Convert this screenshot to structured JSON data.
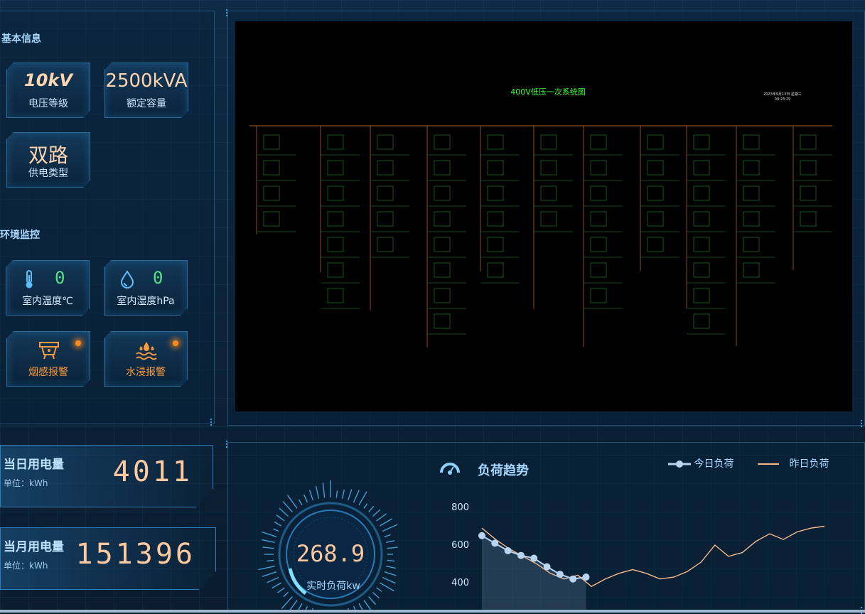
{
  "basic_info": {
    "title": "基本信息",
    "voltage": {
      "value": "10kV",
      "label": "电压等级"
    },
    "capacity": {
      "value": "2500kVA",
      "label": "额定容量"
    },
    "supply": {
      "value": "双路",
      "label": "供电类型"
    }
  },
  "env": {
    "title": "环境监控",
    "temperature": {
      "value": "0",
      "label": "室内温度℃",
      "icon": "thermometer-icon"
    },
    "humidity": {
      "value": "0",
      "label": "室内湿度hPa",
      "icon": "droplet-icon"
    },
    "smoke": {
      "label": "烟感报警",
      "icon": "smoke-detector-icon"
    },
    "water": {
      "label": "水浸报警",
      "icon": "water-flood-icon"
    }
  },
  "energy": {
    "daily": {
      "title": "当日用电量",
      "unit": "单位：kWh",
      "value": "4011"
    },
    "monthly": {
      "title": "当月用电量",
      "unit": "单位：kWh",
      "value": "151396"
    }
  },
  "gauge": {
    "value": "268.9",
    "label": "实时负荷kw"
  },
  "diagram": {
    "title": "400V低压一次系统图",
    "datetime": "2023年9月13日 星期三",
    "time": "09:23:29"
  },
  "chart_data": {
    "type": "line",
    "title": "负荷趋势",
    "ylim": [
      400,
      800
    ],
    "yticks": [
      800,
      600,
      400
    ],
    "series": [
      {
        "name": "今日负荷",
        "color": "#b8d4f0",
        "values": [
          650,
          610,
          570,
          545,
          530,
          485,
          445,
          420,
          430
        ]
      },
      {
        "name": "昨日负荷",
        "color": "#f5b98a",
        "values": [
          690,
          630,
          580,
          540,
          500,
          450,
          420,
          440,
          380,
          420,
          450,
          470,
          450,
          420,
          430,
          460,
          510,
          600,
          540,
          560,
          620,
          660,
          630,
          670,
          690,
          700
        ]
      }
    ]
  },
  "colors": {
    "accent": "#3aa0e0",
    "alarm": "#ff8a1c",
    "number": "#ffc9a0",
    "green": "#55e08a"
  }
}
